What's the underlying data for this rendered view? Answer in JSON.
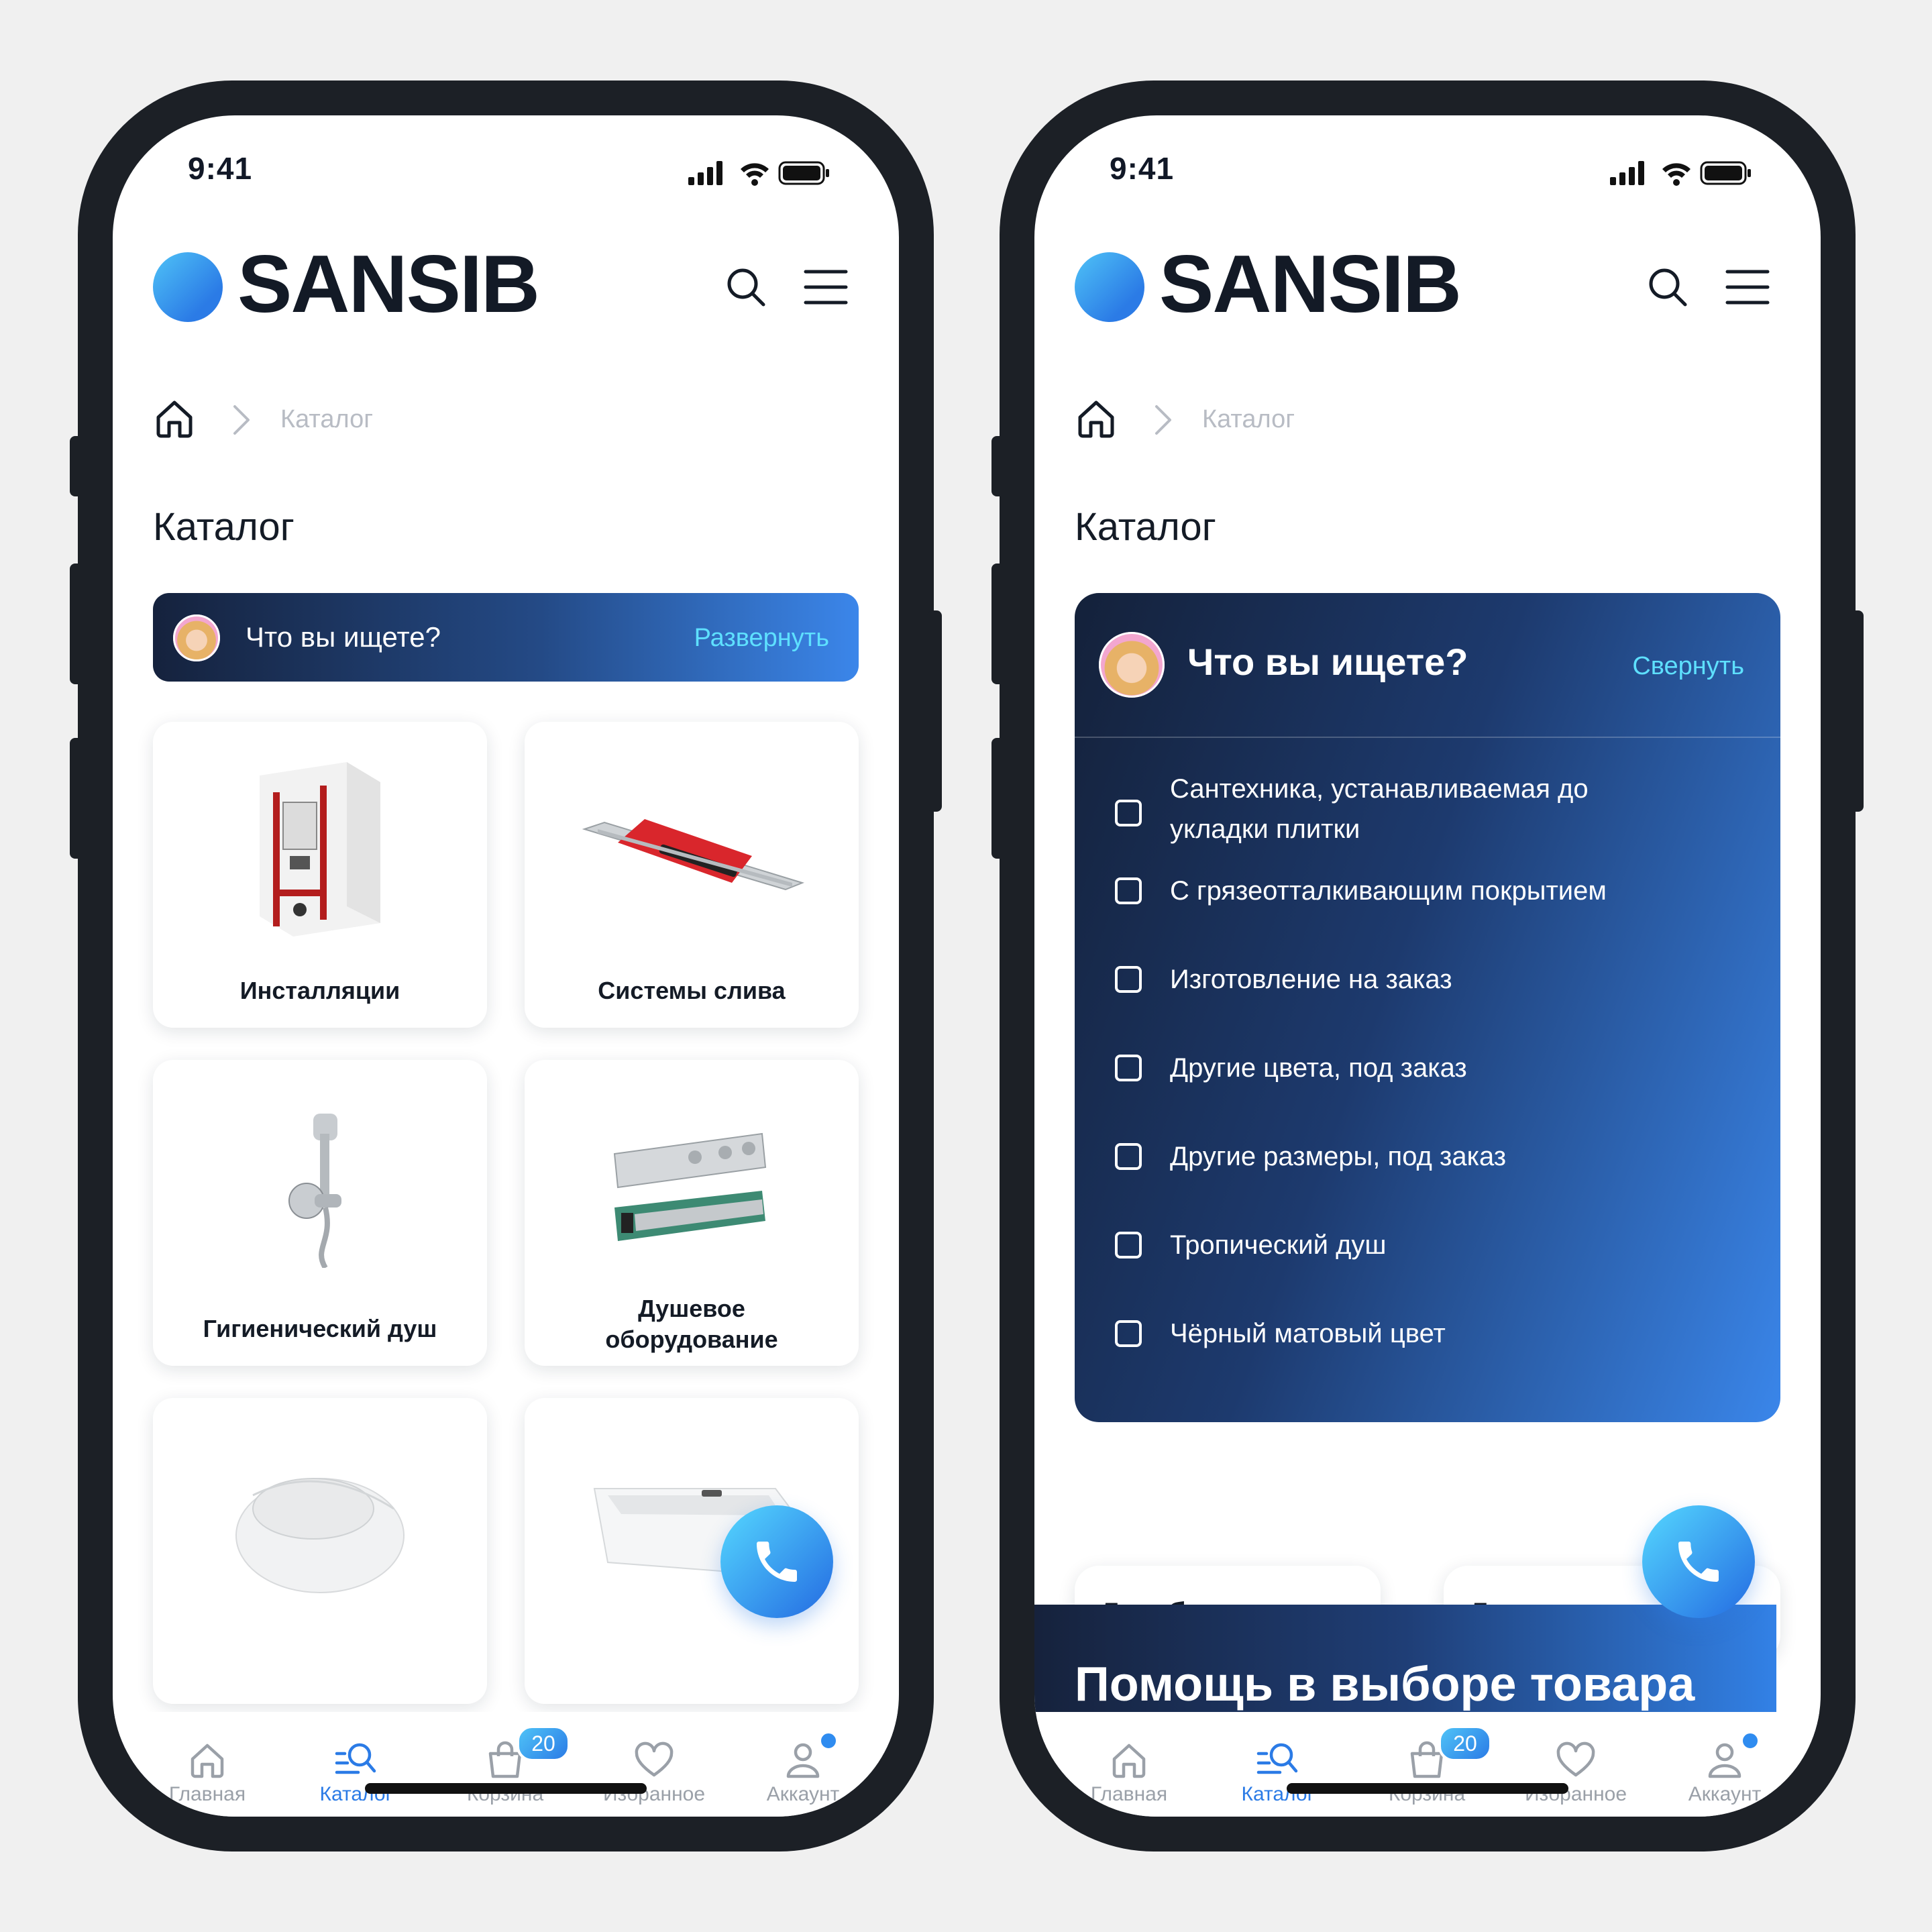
{
  "status": {
    "time": "9:41"
  },
  "brand": {
    "name": "SANSIB"
  },
  "breadcrumb": {
    "current": "Каталог"
  },
  "page_title": "Каталог",
  "search_widget": {
    "question": "Что вы ищете?",
    "expand_label": "Развернуть",
    "collapse_label": "Свернуть",
    "options": [
      "Сантехника, устанавливаемая до укладки плитки",
      "С грязеотталкивающим покрытием",
      "Изготовление на заказ",
      "Другие цвета, под заказ",
      "Другие размеры, под заказ",
      "Тропический душ",
      "Чёрный матовый цвет"
    ]
  },
  "categories": [
    {
      "label": "Инсталляции",
      "icon": "installation-frame-image"
    },
    {
      "label": "Системы слива",
      "icon": "drain-channel-image"
    },
    {
      "label": "Гигиенический душ",
      "icon": "bidet-shower-image"
    },
    {
      "label": "Душевое оборудование",
      "icon": "shower-thermostat-image"
    },
    {
      "label": "",
      "icon": "wall-hung-toilet-image"
    },
    {
      "label": "",
      "icon": "bathtub-image"
    }
  ],
  "subcategories": [
    "Для биде",
    "Для унитаза"
  ],
  "help_banner": "Помощь в выборе товара",
  "tabbar": {
    "items": [
      {
        "label": "Главная",
        "icon": "home-icon"
      },
      {
        "label": "Каталог",
        "icon": "catalog-search-icon",
        "active": true
      },
      {
        "label": "Корзина",
        "icon": "cart-icon",
        "badge": "20"
      },
      {
        "label": "Избранное",
        "icon": "heart-icon"
      },
      {
        "label": "Аккаунт",
        "icon": "account-icon",
        "dot": true
      }
    ]
  },
  "colors": {
    "accent": "#2b7be6",
    "accent_light": "#5ee0ff",
    "dark": "#14213a"
  }
}
